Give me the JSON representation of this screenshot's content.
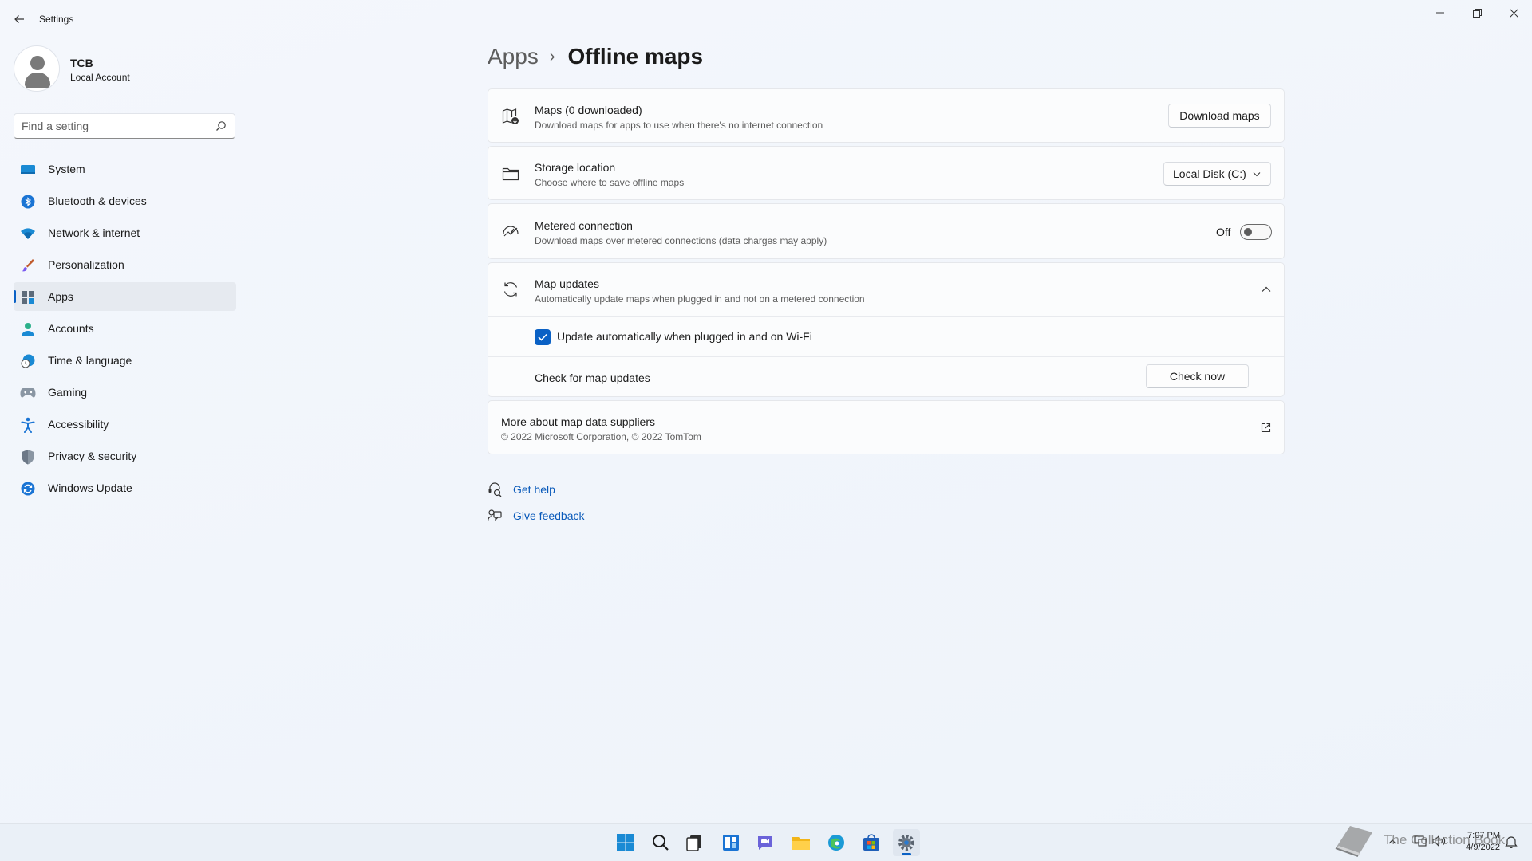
{
  "window": {
    "title": "Settings"
  },
  "profile": {
    "name": "TCB",
    "account_type": "Local Account"
  },
  "search": {
    "placeholder": "Find a setting"
  },
  "nav": {
    "items": [
      {
        "label": "System",
        "icon": "monitor-icon"
      },
      {
        "label": "Bluetooth & devices",
        "icon": "bluetooth-icon"
      },
      {
        "label": "Network & internet",
        "icon": "wifi-icon"
      },
      {
        "label": "Personalization",
        "icon": "brush-icon"
      },
      {
        "label": "Apps",
        "icon": "apps-icon",
        "active": true
      },
      {
        "label": "Accounts",
        "icon": "person-icon"
      },
      {
        "label": "Time & language",
        "icon": "globe-clock-icon"
      },
      {
        "label": "Gaming",
        "icon": "gamepad-icon"
      },
      {
        "label": "Accessibility",
        "icon": "accessibility-icon"
      },
      {
        "label": "Privacy & security",
        "icon": "shield-icon"
      },
      {
        "label": "Windows Update",
        "icon": "update-icon"
      }
    ]
  },
  "breadcrumb": {
    "parent": "Apps",
    "separator": "›",
    "current": "Offline maps"
  },
  "maps": {
    "title": "Maps (0 downloaded)",
    "subtitle": "Download maps for apps to use when there's no internet connection",
    "button": "Download maps"
  },
  "storage": {
    "title": "Storage location",
    "subtitle": "Choose where to save offline maps",
    "selected": "Local Disk (C:)"
  },
  "metered": {
    "title": "Metered connection",
    "subtitle": "Download maps over metered connections (data charges may apply)",
    "state_label": "Off",
    "on": false
  },
  "updates": {
    "title": "Map updates",
    "subtitle": "Automatically update maps when plugged in and not on a metered connection",
    "expanded": true,
    "auto_update_label": "Update automatically when plugged in and on Wi-Fi",
    "auto_update_checked": true,
    "check_label": "Check for map updates",
    "check_button": "Check now"
  },
  "suppliers": {
    "title": "More about map data suppliers",
    "subtitle": "© 2022 Microsoft Corporation, © 2022 TomTom"
  },
  "help": {
    "get_help": "Get help",
    "give_feedback": "Give feedback"
  },
  "taskbar": {
    "apps": [
      "start-icon",
      "search-icon",
      "task-view-icon",
      "widgets-icon",
      "chat-icon",
      "file-explorer-icon",
      "edge-icon",
      "store-icon",
      "settings-icon"
    ],
    "time": "7:07 PM",
    "date": "4/9/2022"
  },
  "watermark": {
    "text": "The Collection Book"
  },
  "colors": {
    "accent": "#0a61c5",
    "background": "#f3f6fb",
    "card": "#fbfcfd"
  }
}
